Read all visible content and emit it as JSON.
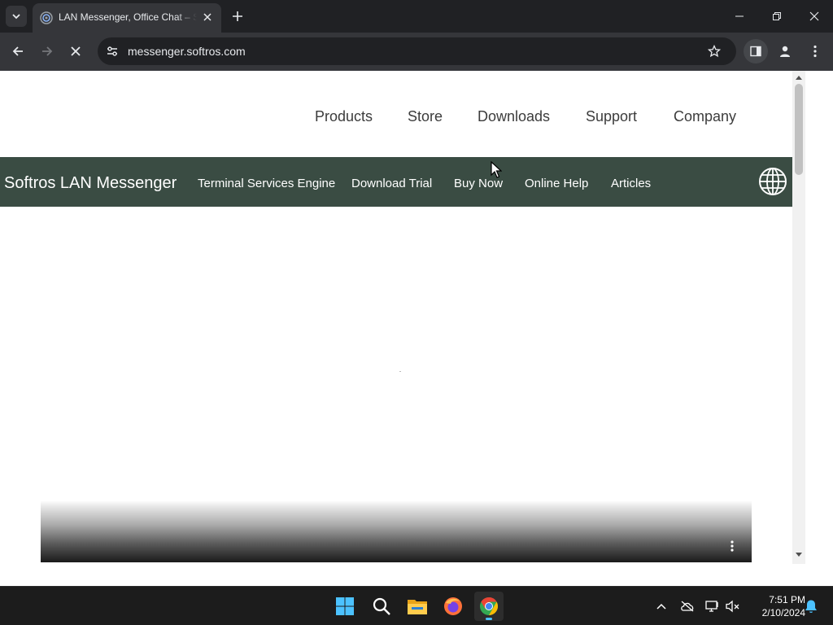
{
  "browser": {
    "tab_title": "LAN Messenger, Office Chat – Softros",
    "url": "messenger.softros.com"
  },
  "page": {
    "top_nav": [
      "Products",
      "Store",
      "Downloads",
      "Support",
      "Company"
    ],
    "brand": "Softros LAN Messenger",
    "sub_nav": [
      "Terminal Services Engine",
      "Download Trial",
      "Buy Now",
      "Online Help",
      "Articles"
    ]
  },
  "colors": {
    "green_bar": "#3a4c43",
    "chrome_dark": "#202124",
    "chrome_toolbar": "#35363a",
    "taskbar": "#1c1c1c",
    "accent": "#4cc2ff"
  },
  "taskbar": {
    "time": "7:51 PM",
    "date": "2/10/2024",
    "apps": [
      "windows-start",
      "search",
      "file-explorer",
      "firefox",
      "chrome"
    ]
  }
}
